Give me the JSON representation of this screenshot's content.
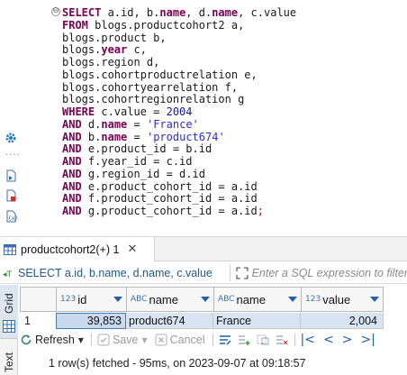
{
  "editor": {
    "lines": [
      [
        {
          "t": "SELECT",
          "c": "kw"
        },
        {
          "t": " a.id, b.",
          "c": "txt"
        },
        {
          "t": "name",
          "c": "kw"
        },
        {
          "t": ", d.",
          "c": "txt"
        },
        {
          "t": "name",
          "c": "kw"
        },
        {
          "t": ", c.value",
          "c": "txt"
        }
      ],
      [
        {
          "t": "FROM",
          "c": "kw"
        },
        {
          "t": " blogs.productcohort2 a,",
          "c": "txt"
        }
      ],
      [
        {
          "t": "blogs.product b,",
          "c": "txt"
        }
      ],
      [
        {
          "t": "blogs.",
          "c": "txt"
        },
        {
          "t": "year",
          "c": "kw"
        },
        {
          "t": " c,",
          "c": "txt"
        }
      ],
      [
        {
          "t": "blogs.region d,",
          "c": "txt"
        }
      ],
      [
        {
          "t": "blogs.cohortproductrelation e,",
          "c": "txt"
        }
      ],
      [
        {
          "t": "blogs.cohortyearrelation f,",
          "c": "txt"
        }
      ],
      [
        {
          "t": "blogs.cohortregionrelation g",
          "c": "txt"
        }
      ],
      [
        {
          "t": "WHERE",
          "c": "kw"
        },
        {
          "t": " c.value = ",
          "c": "txt"
        },
        {
          "t": "2004",
          "c": "num"
        }
      ],
      [
        {
          "t": "AND",
          "c": "kw"
        },
        {
          "t": " d.",
          "c": "txt"
        },
        {
          "t": "name",
          "c": "kw"
        },
        {
          "t": " = ",
          "c": "txt"
        },
        {
          "t": "'France'",
          "c": "str"
        }
      ],
      [
        {
          "t": "AND",
          "c": "kw"
        },
        {
          "t": " b.",
          "c": "txt"
        },
        {
          "t": "name",
          "c": "kw"
        },
        {
          "t": " = ",
          "c": "txt"
        },
        {
          "t": "'product674'",
          "c": "str"
        }
      ],
      [
        {
          "t": "AND",
          "c": "kw"
        },
        {
          "t": " e.product_id = b.id",
          "c": "txt"
        }
      ],
      [
        {
          "t": "AND",
          "c": "kw"
        },
        {
          "t": " f.year_id = c.id",
          "c": "txt"
        }
      ],
      [
        {
          "t": "AND",
          "c": "kw"
        },
        {
          "t": " g.region_id = d.id",
          "c": "txt"
        }
      ],
      [
        {
          "t": "AND",
          "c": "kw"
        },
        {
          "t": " e.product_cohort_id = a.id",
          "c": "txt"
        }
      ],
      [
        {
          "t": "AND",
          "c": "kw"
        },
        {
          "t": " f.product_cohort_id = a.id",
          "c": "txt"
        }
      ],
      [
        {
          "t": "AND",
          "c": "kw"
        },
        {
          "t": " g.product_cohort_id = a.id",
          "c": "txt"
        },
        {
          "t": ";",
          "c": "red"
        }
      ]
    ],
    "fold_marker": "⊖",
    "gutter_dots": "....",
    "gutter_icons": [
      "gear-icon",
      "execute-script-icon",
      "explain-plan-icon",
      "variables-icon"
    ]
  },
  "results": {
    "tab_label": "productcohort2(+) 1",
    "tab_close": "✕",
    "filter_query": "SELECT a.id, b.name, d.name, c.value",
    "filter_placeholder": "Enter a SQL expression to filter results",
    "columns": [
      {
        "type_icon": "123",
        "name": "id"
      },
      {
        "type_icon": "ABC",
        "name": "name"
      },
      {
        "type_icon": "ABC",
        "name": "name"
      },
      {
        "type_icon": "123",
        "name": "value"
      }
    ],
    "rows": [
      {
        "num": "1",
        "id": "39,853",
        "bname": "product674",
        "dname": "France",
        "value": "2,004"
      }
    ],
    "side_tabs": {
      "grid": "Grid",
      "text": "Text"
    },
    "toolbar": {
      "refresh": "Refresh",
      "save": "Save",
      "cancel": "Cancel"
    },
    "status": "1 row(s) fetched - 95ms, on 2023-09-07 at 09:18:57"
  },
  "colors": {
    "keyword": "#800052",
    "string": "#2a2af0",
    "selection": "#c9daf0",
    "accent": "#1f5fb0"
  }
}
